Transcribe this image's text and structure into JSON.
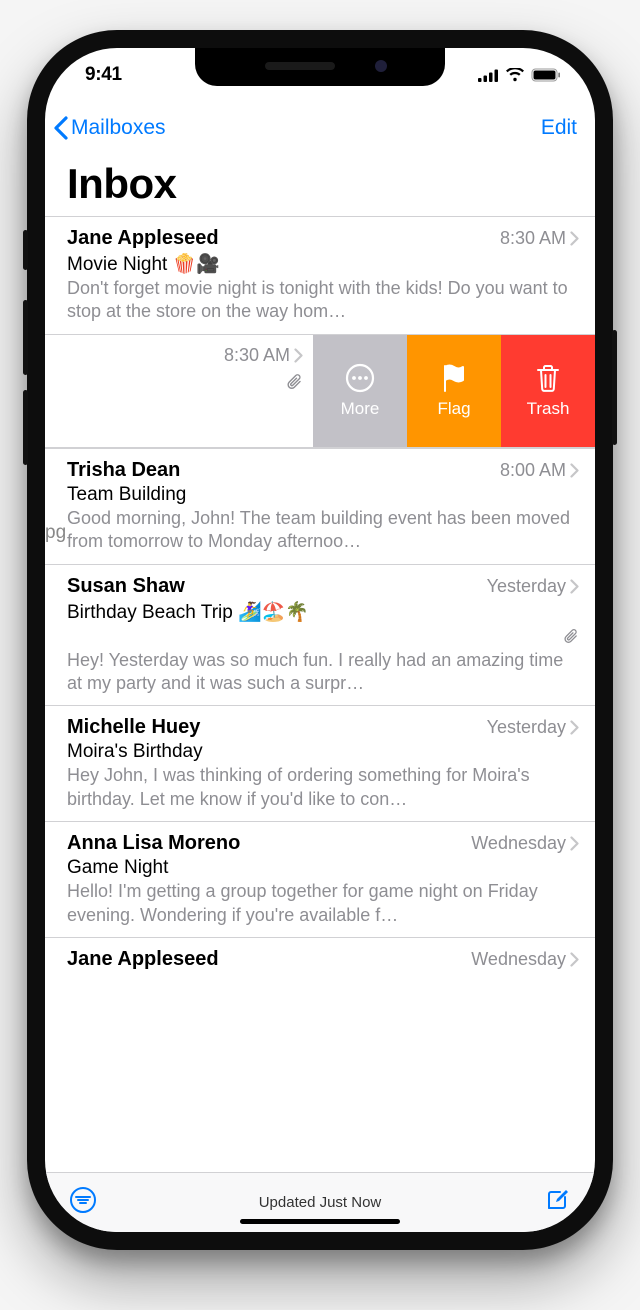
{
  "status": {
    "time": "9:41"
  },
  "nav": {
    "back": "Mailboxes",
    "edit": "Edit",
    "title": "Inbox"
  },
  "swipe": {
    "date": "8:30 AM",
    "more": "More",
    "flag": "Flag",
    "trash": "Trash",
    "stray": "pg"
  },
  "messages": [
    {
      "sender": "Jane Appleseed",
      "date": "8:30 AM",
      "subject": "Movie Night 🍿🎥",
      "preview": "Don't forget movie night is tonight with the kids! Do you want to stop at the store on the way hom…",
      "attachment": false
    },
    {
      "sender": "Trisha Dean",
      "date": "8:00 AM",
      "subject": "Team Building",
      "preview": "Good morning, John! The team building event has been moved from tomorrow to Monday afternoo…",
      "attachment": false
    },
    {
      "sender": "Susan Shaw",
      "date": "Yesterday",
      "subject": "Birthday Beach Trip 🏄‍♀️🏖️🌴",
      "preview": "Hey! Yesterday was so much fun. I really had an amazing time at my party and it was such a surpr…",
      "attachment": true
    },
    {
      "sender": "Michelle Huey",
      "date": "Yesterday",
      "subject": "Moira's Birthday",
      "preview": "Hey John, I was thinking of ordering something for Moira's birthday. Let me know if you'd like to con…",
      "attachment": false
    },
    {
      "sender": "Anna Lisa Moreno",
      "date": "Wednesday",
      "subject": "Game Night",
      "preview": "Hello! I'm getting a group together for game night on Friday evening. Wondering if you're available f…",
      "attachment": false
    },
    {
      "sender": "Jane Appleseed",
      "date": "Wednesday",
      "subject": "",
      "preview": "",
      "attachment": false
    }
  ],
  "toolbar": {
    "status": "Updated Just Now"
  }
}
